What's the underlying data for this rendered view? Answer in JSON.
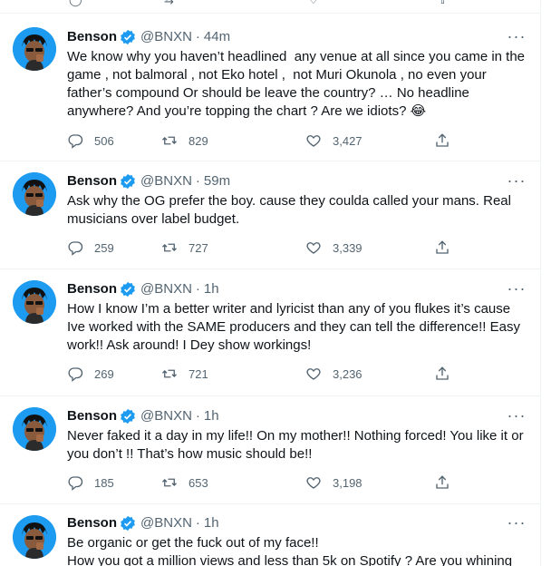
{
  "tweets": [
    {
      "name": "Benson",
      "handle": "@BNXN",
      "separator": "·",
      "time": "44m",
      "text": "We know why you haven’t headlined  any venue at all since you came in the game , not balmoral , not Eko hotel ,  not Muri Okunola , no even your father’s compound Or should be leave the country? … No headline anywhere? And you’re topping the chart ? Are we idiots? 😂",
      "replies": "506",
      "retweets": "829",
      "likes": "3,427"
    },
    {
      "name": "Benson",
      "handle": "@BNXN",
      "separator": "·",
      "time": "59m",
      "text": "Ask why the OG prefer the boy. cause they coulda called your mans. Real musicians over label budget.",
      "replies": "259",
      "retweets": "727",
      "likes": "3,339"
    },
    {
      "name": "Benson",
      "handle": "@BNXN",
      "separator": "·",
      "time": "1h",
      "text": "How I know I’m a better writer and lyricist than any of you flukes it’s cause Ive worked with the SAME producers and they can tell the difference!! Easy work!! Ask around! I Dey show workings!",
      "replies": "269",
      "retweets": "721",
      "likes": "3,236"
    },
    {
      "name": "Benson",
      "handle": "@BNXN",
      "separator": "·",
      "time": "1h",
      "text": "Never faked it a day in my life!! On my mother!! Nothing forced! You like it or you don’t !! That’s how music should be!!",
      "replies": "185",
      "retweets": "653",
      "likes": "3,198"
    },
    {
      "name": "Benson",
      "handle": "@BNXN",
      "separator": "·",
      "time": "1h",
      "text": "Be organic or get the fuck out of my face!!\nHow you got a million views and less than 5k on Spotify ? Are you whining",
      "replies": "",
      "retweets": "",
      "likes": ""
    }
  ],
  "icons": {
    "verified": "verified-badge-icon",
    "more": "more-icon",
    "reply": "reply-icon",
    "retweet": "retweet-icon",
    "like": "like-icon",
    "share": "share-icon"
  },
  "colors": {
    "accent": "#1d9bf0",
    "secondary_text": "#536471",
    "divider": "#eff3f4"
  }
}
